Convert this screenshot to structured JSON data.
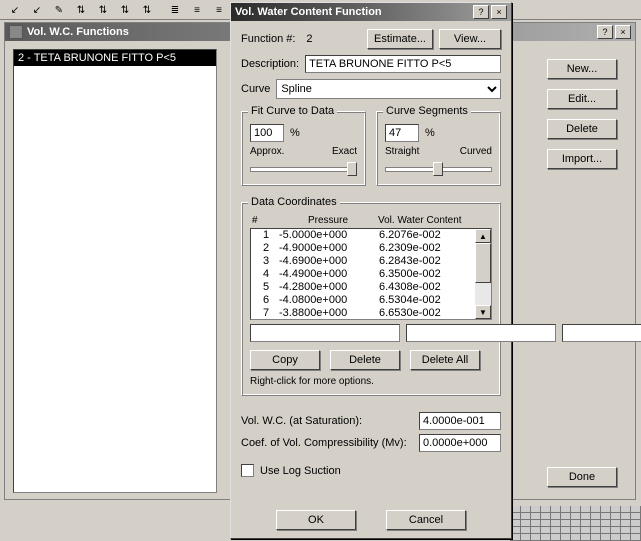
{
  "toolbar_icons": [
    "↙",
    "↙",
    "✎",
    "⇅",
    "⇅",
    "⇅",
    "⇅",
    "≣",
    "≡",
    "≡"
  ],
  "parent_window": {
    "title": "Vol. W.C. Functions",
    "help": "?",
    "close": "×",
    "list": [
      "2 - TETA BRUNONE FITTO P<5"
    ],
    "buttons": {
      "new": "New...",
      "edit": "Edit...",
      "delete": "Delete",
      "import": "Import...",
      "done": "Done"
    }
  },
  "dialog": {
    "title": "Vol. Water Content Function",
    "help": "?",
    "close": "×",
    "func_num_label": "Function #:",
    "func_num": "2",
    "estimate": "Estimate...",
    "view": "View...",
    "desc_label": "Description:",
    "desc": "TETA BRUNONE FITTO P<5",
    "curve_label": "Curve",
    "curve": "Spline",
    "fit": {
      "legend": "Fit Curve to Data",
      "value": "100",
      "pct": "%",
      "left": "Approx.",
      "right": "Exact"
    },
    "seg": {
      "legend": "Curve Segments",
      "value": "47",
      "pct": "%",
      "left": "Straight",
      "right": "Curved"
    },
    "coords": {
      "legend": "Data Coordinates",
      "h_num": "#",
      "h_p": "Pressure",
      "h_v": "Vol. Water Content",
      "rows": [
        {
          "n": "1",
          "p": "-5.0000e+000",
          "v": "6.2076e-002"
        },
        {
          "n": "2",
          "p": "-4.9000e+000",
          "v": "6.2309e-002"
        },
        {
          "n": "3",
          "p": "-4.6900e+000",
          "v": "6.2843e-002"
        },
        {
          "n": "4",
          "p": "-4.4900e+000",
          "v": "6.3500e-002"
        },
        {
          "n": "5",
          "p": "-4.2800e+000",
          "v": "6.4308e-002"
        },
        {
          "n": "6",
          "p": "-4.0800e+000",
          "v": "6.5304e-002"
        },
        {
          "n": "7",
          "p": "-3.8800e+000",
          "v": "6.6530e-002"
        }
      ],
      "copy": "Copy",
      "delete": "Delete",
      "delete_all": "Delete All",
      "right_click": "Right-click for more options."
    },
    "sat_label": "Vol. W.C. (at Saturation):",
    "sat_value": "4.0000e-001",
    "mv_label": "Coef. of Vol. Compressibility (Mv):",
    "mv_value": "0.0000e+000",
    "use_log": "Use Log Suction",
    "ok": "OK",
    "cancel": "Cancel"
  }
}
